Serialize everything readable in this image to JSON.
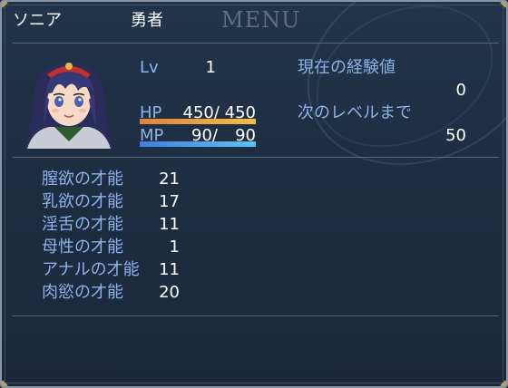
{
  "actor": {
    "name": "ソニア",
    "class": "勇者",
    "level_label": "Lv",
    "level": "1",
    "hp_label": "HP",
    "hp": "450/ 450",
    "hp_ratio": 1.0,
    "mp_label": "MP",
    "mp_current": "90/",
    "mp_max": "90",
    "mp_ratio": 1.0
  },
  "menu_watermark": "MENU",
  "exp": {
    "current_label": "現在の経験値",
    "current_value": "0",
    "next_label": "次のレベルまで",
    "next_value": "50"
  },
  "talents": [
    {
      "label": "膣欲の才能",
      "value": "21"
    },
    {
      "label": "乳欲の才能",
      "value": "17"
    },
    {
      "label": "淫舌の才能",
      "value": "11"
    },
    {
      "label": "母性の才能",
      "value": "1"
    },
    {
      "label": "アナルの才能",
      "value": "11"
    },
    {
      "label": "肉慾の才能",
      "value": "20"
    }
  ],
  "colors": {
    "system_text": "#8fb0e8",
    "normal_text": "#ffffff",
    "hp_gauge_start": "#e0803c",
    "hp_gauge_end": "#f0c040",
    "mp_gauge_start": "#4080e0",
    "mp_gauge_end": "#60c0f0"
  }
}
